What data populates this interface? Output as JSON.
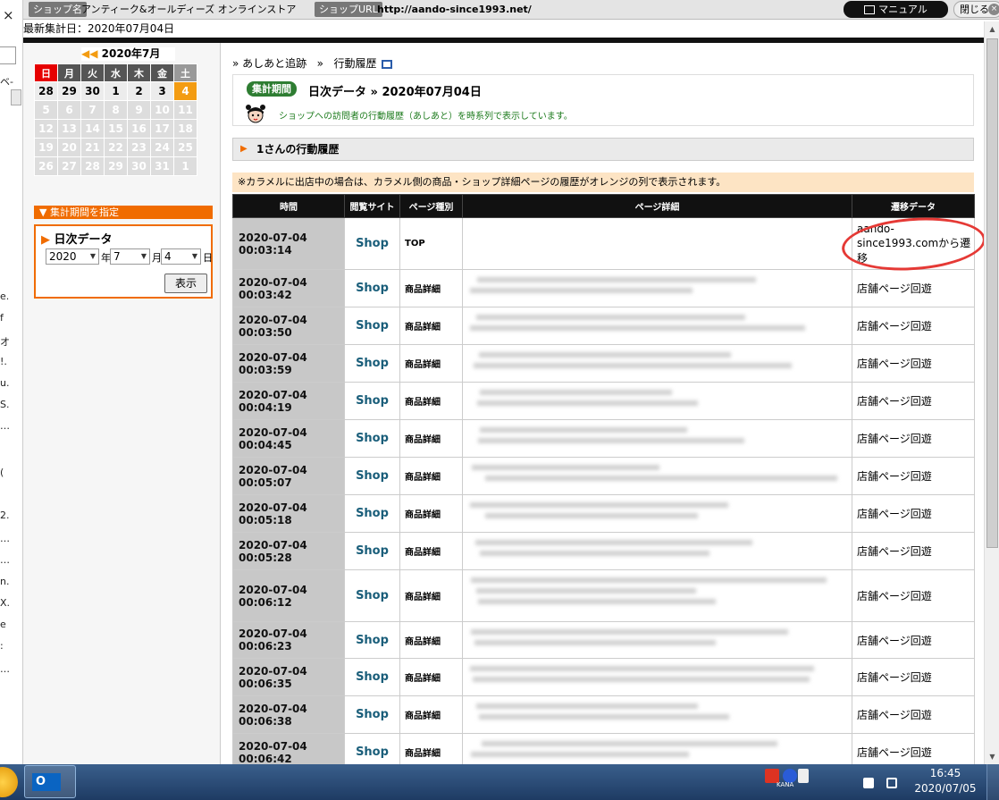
{
  "topbar": {
    "shop_label": "ショップ名",
    "shop_name": "アンティーク&オールディーズ オンラインストア",
    "url_label": "ショップURL",
    "url": "http://aando-since1993.net/",
    "manual": "マニュアル",
    "close": "閉じる",
    "close_x": "×"
  },
  "latest_date": "最新集計日：2020年07月04日",
  "left_strip": {
    "close_glyph": "×",
    "chars": [
      "ベ-",
      "e.",
      "f",
      "オ",
      "!.",
      "u.",
      "S.",
      "…",
      "(",
      "2.",
      "…",
      "…",
      "n.",
      "X.",
      "e",
      ":",
      "…"
    ]
  },
  "calendar": {
    "title": "2020年7月",
    "prev_arrow": "◀◀",
    "headers": [
      "日",
      "月",
      "火",
      "水",
      "木",
      "金",
      "土"
    ],
    "rows": [
      [
        "28",
        "29",
        "30",
        "1",
        "2",
        "3",
        "4"
      ],
      [
        "5",
        "6",
        "7",
        "8",
        "9",
        "10",
        "11"
      ],
      [
        "12",
        "13",
        "14",
        "15",
        "16",
        "17",
        "18"
      ],
      [
        "19",
        "20",
        "21",
        "22",
        "23",
        "24",
        "25"
      ],
      [
        "26",
        "27",
        "28",
        "29",
        "30",
        "31",
        "1"
      ]
    ]
  },
  "period": {
    "head": "集計期間を指定",
    "head_arrow": "▼",
    "title_arrow": "▶",
    "title": "日次データ",
    "year": "2020",
    "year_unit": "年",
    "month": "7",
    "month_unit": "月",
    "day": "4",
    "day_unit": "日",
    "show": "表示",
    "dd_glyph": "▼"
  },
  "breadcrumb": {
    "sep1": "»",
    "item1": "あしあと追跡",
    "sep2": "»",
    "item2": "行動履歴"
  },
  "info": {
    "badge": "集計期間",
    "period_text": "日次データ » 2020年07月04日",
    "desc": "ショップへの訪問者の行動履歴（あしあと）を時系列で表示しています。"
  },
  "section_title": "1さんの行動履歴",
  "section_arrow": "▶",
  "note": "※カラメルに出店中の場合は、カラメル側の商品・ショップ詳細ページの履歴がオレンジの列で表示されます。",
  "table": {
    "headers": [
      "時間",
      "閲覧サイト",
      "ページ種別",
      "ページ詳細",
      "遷移データ"
    ],
    "rows": [
      {
        "time": "2020-07-04 00:03:14",
        "site": "Shop",
        "type": "TOP",
        "trans": "aando-since1993.comから遷移"
      },
      {
        "time": "2020-07-04 00:03:42",
        "site": "Shop",
        "type": "商品詳細",
        "trans": "店舗ページ回遊"
      },
      {
        "time": "2020-07-04 00:03:50",
        "site": "Shop",
        "type": "商品詳細",
        "trans": "店舗ページ回遊"
      },
      {
        "time": "2020-07-04 00:03:59",
        "site": "Shop",
        "type": "商品詳細",
        "trans": "店舗ページ回遊"
      },
      {
        "time": "2020-07-04 00:04:19",
        "site": "Shop",
        "type": "商品詳細",
        "trans": "店舗ページ回遊"
      },
      {
        "time": "2020-07-04 00:04:45",
        "site": "Shop",
        "type": "商品詳細",
        "trans": "店舗ページ回遊"
      },
      {
        "time": "2020-07-04 00:05:07",
        "site": "Shop",
        "type": "商品詳細",
        "trans": "店舗ページ回遊"
      },
      {
        "time": "2020-07-04 00:05:18",
        "site": "Shop",
        "type": "商品詳細",
        "trans": "店舗ページ回遊"
      },
      {
        "time": "2020-07-04 00:05:28",
        "site": "Shop",
        "type": "商品詳細",
        "trans": "店舗ページ回遊"
      },
      {
        "time": "2020-07-04 00:06:12",
        "site": "Shop",
        "type": "商品詳細",
        "trans": "店舗ページ回遊"
      },
      {
        "time": "2020-07-04 00:06:23",
        "site": "Shop",
        "type": "商品詳細",
        "trans": "店舗ページ回遊"
      },
      {
        "time": "2020-07-04 00:06:35",
        "site": "Shop",
        "type": "商品詳細",
        "trans": "店舗ページ回遊"
      },
      {
        "time": "2020-07-04 00:06:38",
        "site": "Shop",
        "type": "商品詳細",
        "trans": "店舗ページ回遊"
      },
      {
        "time": "2020-07-04 00:06:42",
        "site": "Shop",
        "type": "商品詳細",
        "trans": "店舗ページ回遊"
      }
    ]
  },
  "taskbar": {
    "kana": "KANA",
    "time": "16:45",
    "date": "2020/07/05",
    "outlook_letter": "O"
  },
  "colors": {
    "accent_orange": "#f06c00",
    "calendar_today": "#f39c12",
    "badge_green": "#2e7d32",
    "site_link": "#1a5e7a",
    "annotation_red": "#e53935"
  }
}
